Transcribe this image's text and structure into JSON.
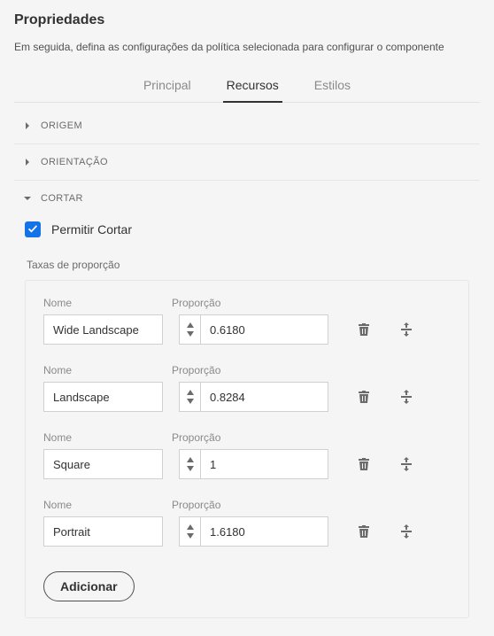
{
  "title": "Propriedades",
  "subtitle": "Em seguida, defina as configurações da política selecionada para configurar o componente",
  "tabs": {
    "main": "Principal",
    "resources": "Recursos",
    "styles": "Estilos"
  },
  "sections": {
    "origem": "ORIGEM",
    "orientacao": "ORIENTAÇÃO",
    "cortar": "CORTAR"
  },
  "allow_crop": {
    "label": "Permitir Cortar",
    "checked": true
  },
  "ratios_label": "Taxas de proporção",
  "col_labels": {
    "name": "Nome",
    "ratio": "Proporção"
  },
  "rows": [
    {
      "name": "Wide Landscape",
      "ratio": "0.6180"
    },
    {
      "name": "Landscape",
      "ratio": "0.8284"
    },
    {
      "name": "Square",
      "ratio": "1"
    },
    {
      "name": "Portrait",
      "ratio": "1.6180"
    }
  ],
  "add_label": "Adicionar"
}
